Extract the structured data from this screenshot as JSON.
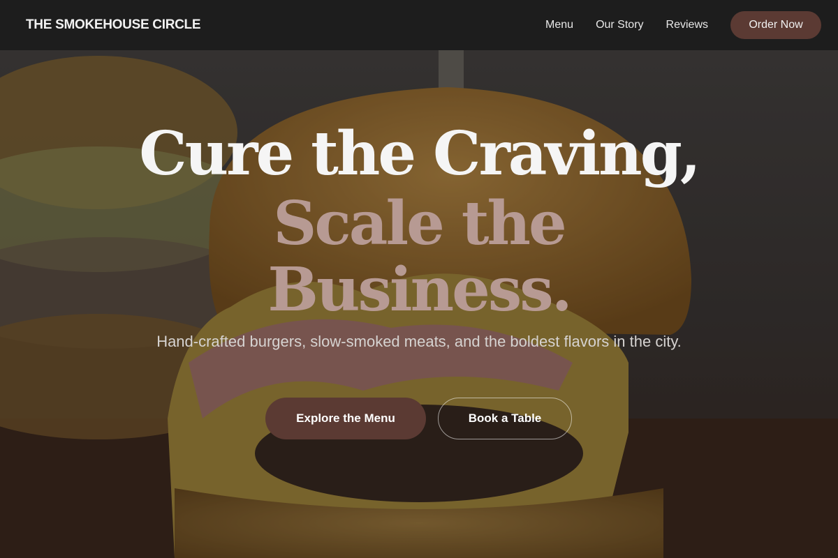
{
  "nav": {
    "brand": "THE SMOKEHOUSE CIRCLE",
    "links": [
      "Menu",
      "Our Story",
      "Reviews"
    ],
    "cta": "Order Now"
  },
  "hero": {
    "headline_line1": "Cure the Craving,",
    "headline_line2": "Scale the",
    "headline_line3": "Business.",
    "subtitle": "Hand-crafted burgers, slow-smoked meats, and the boldest flavors in the city.",
    "primary_button": "Explore the Menu",
    "secondary_button": "Book a Table"
  },
  "colors": {
    "nav_background": "#1d1d1d",
    "accent": "#5b3a33",
    "headline_accent": "#b79a93"
  }
}
